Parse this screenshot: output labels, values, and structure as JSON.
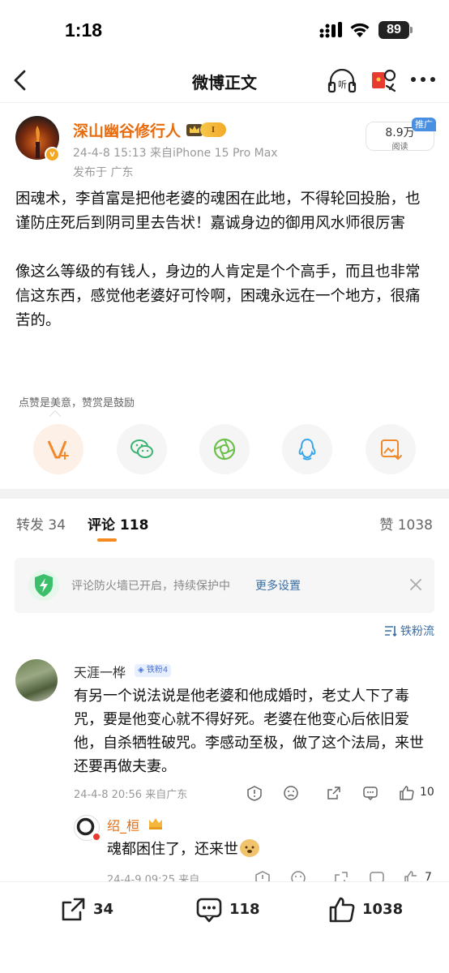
{
  "status_bar": {
    "time": "1:18",
    "battery": "89"
  },
  "nav": {
    "title": "微博正文",
    "listen_label": "听"
  },
  "post": {
    "author": "深山幽谷修行人",
    "level_badge": "I",
    "verified_mark": "v",
    "meta": "24-4-8 15:13  来自iPhone 15 Pro Max",
    "location": "发布于 广东",
    "reads_count": "8.9万",
    "reads_label": "阅读",
    "promo_tag": "推广",
    "paragraphs": [
      "困魂术，李首富是把他老婆的魂困在此地，不得轮回投胎，也谨防庄死后到阴司里去告状！嘉诚身边的御用风水师很厉害",
      "像这么等级的有钱人，身边的人肯定是个个高手，而且也非常信这东西，感觉他老婆好可怜啊，困魂永远在一个地方，很痛苦的。"
    ],
    "like_tip": "点赞是美意，赞赏是鼓励"
  },
  "tabs": {
    "repost": "转发 34",
    "comments": "评论 118",
    "likes": "赞 1038"
  },
  "firewall": {
    "text": "评论防火墙已开启，持续保护中",
    "link": "更多设置"
  },
  "sort_label": "铁粉流",
  "comments": [
    {
      "name": "天涯一桦",
      "badge": "铁粉4",
      "body": "有另一个说法说是他老婆和他成婚时，老丈人下了毒咒，要是他变心就不得好死。老婆在他变心后依旧爱他，自杀牺牲破咒。李感动至极，做了这个法局，来世还要再做夫妻。",
      "meta": "24-4-8 20:56  来自广东",
      "like_count": "10",
      "reply": {
        "name": "绍_桓",
        "body": "魂都困住了，还来世",
        "meta": "24-4-9 09:25  来自",
        "like_count": "7"
      }
    }
  ],
  "bottom": {
    "repost_count": "34",
    "comment_count": "118",
    "like_count": "1038"
  },
  "colors": {
    "accent_orange": "#e86b0c",
    "link_blue": "#3a6ea5",
    "promo_blue": "#4a90e2"
  }
}
